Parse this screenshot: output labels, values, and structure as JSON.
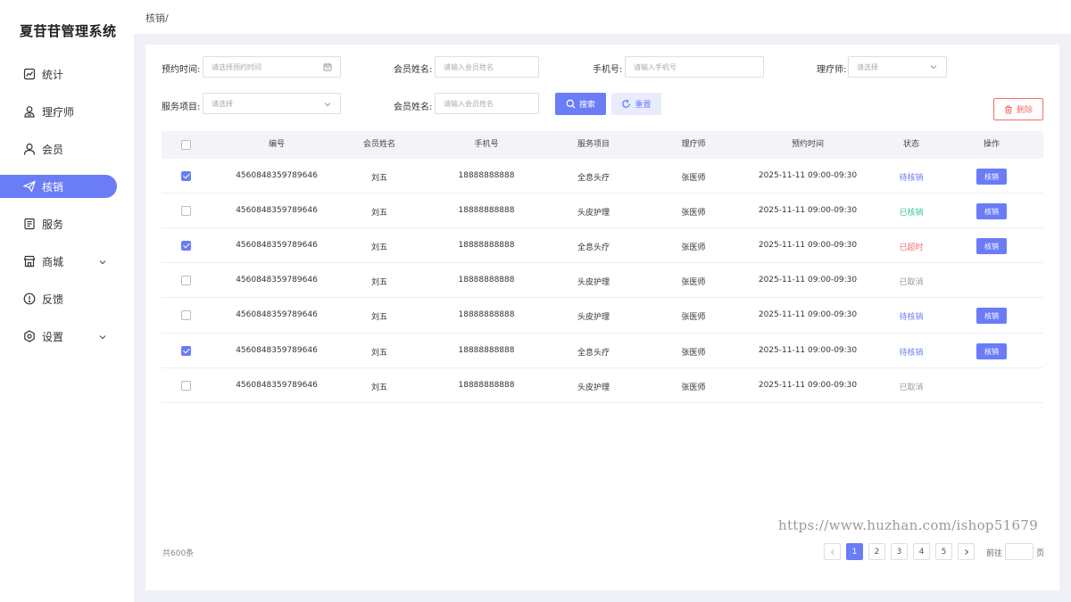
{
  "app": {
    "title": "夏苷苷管理系统"
  },
  "sidebar": {
    "items": [
      {
        "label": "统计",
        "icon": "chart-icon"
      },
      {
        "label": "理疗师",
        "icon": "therapist-icon"
      },
      {
        "label": "会员",
        "icon": "user-icon"
      },
      {
        "label": "核销",
        "icon": "paper-plane-icon",
        "active": true
      },
      {
        "label": "服务",
        "icon": "document-icon"
      },
      {
        "label": "商城",
        "icon": "store-icon",
        "expandable": true
      },
      {
        "label": "反馈",
        "icon": "alert-icon"
      },
      {
        "label": "设置",
        "icon": "gear-icon",
        "expandable": true
      }
    ]
  },
  "breadcrumb": "核销/",
  "filters": {
    "appointment_time": {
      "label": "预约时间:",
      "placeholder": "请选择预约时间"
    },
    "member_name": {
      "label": "会员姓名:",
      "placeholder": "请输入会员姓名"
    },
    "phone": {
      "label": "手机号:",
      "placeholder": "请输入手机号"
    },
    "therapist": {
      "label": "理疗师:",
      "placeholder": "请选择"
    },
    "service": {
      "label": "服务项目:",
      "placeholder": "请选择"
    },
    "member_name_2": {
      "label": "会员姓名:",
      "placeholder": "请输入会员姓名"
    }
  },
  "buttons": {
    "search": "搜索",
    "reset": "重置",
    "delete": "删除"
  },
  "table": {
    "columns": [
      "编号",
      "会员姓名",
      "手机号",
      "服务项目",
      "理疗师",
      "预约时间",
      "状态",
      "操作"
    ],
    "rows": [
      {
        "checked": true,
        "id": "4560848359789646",
        "name": "刘五",
        "phone": "18888888888",
        "service": "全息头疗",
        "therapist": "张医师",
        "time": "2025-11-11 09:00-09:30",
        "status": "待核销",
        "status_color": "#6b7cf7",
        "action": "核销"
      },
      {
        "checked": false,
        "id": "4560848359789646",
        "name": "刘五",
        "phone": "18888888888",
        "service": "头皮护理",
        "therapist": "张医师",
        "time": "2025-11-11 09:00-09:30",
        "status": "已核销",
        "status_color": "#3cc68a",
        "action": "核销"
      },
      {
        "checked": true,
        "id": "4560848359789646",
        "name": "刘五",
        "phone": "18888888888",
        "service": "全息头疗",
        "therapist": "张医师",
        "time": "2025-11-11 09:00-09:30",
        "status": "已超时",
        "status_color": "#f56c6c",
        "action": "核销"
      },
      {
        "checked": false,
        "id": "4560848359789646",
        "name": "刘五",
        "phone": "18888888888",
        "service": "头皮护理",
        "therapist": "张医师",
        "time": "2025-11-11 09:00-09:30",
        "status": "已取消",
        "status_color": "#999999",
        "action": ""
      },
      {
        "checked": false,
        "id": "4560848359789646",
        "name": "刘五",
        "phone": "18888888888",
        "service": "头皮护理",
        "therapist": "张医师",
        "time": "2025-11-11 09:00-09:30",
        "status": "待核销",
        "status_color": "#6b7cf7",
        "action": "核销"
      },
      {
        "checked": true,
        "id": "4560848359789646",
        "name": "刘五",
        "phone": "18888888888",
        "service": "全息头疗",
        "therapist": "张医师",
        "time": "2025-11-11 09:00-09:30",
        "status": "待核销",
        "status_color": "#6b7cf7",
        "action": "核销"
      },
      {
        "checked": false,
        "id": "4560848359789646",
        "name": "刘五",
        "phone": "18888888888",
        "service": "头皮护理",
        "therapist": "张医师",
        "time": "2025-11-11 09:00-09:30",
        "status": "已取消",
        "status_color": "#999999",
        "action": ""
      }
    ]
  },
  "footer": {
    "total": "共600条",
    "pages": [
      "1",
      "2",
      "3",
      "4",
      "5"
    ],
    "current_page": "1",
    "goto_label": "前往",
    "goto_suffix": "页"
  },
  "watermark": "https://www.huzhan.com/ishop51679",
  "colors": {
    "accent": "#6b7cf7",
    "danger": "#f56c6c",
    "success": "#3cc68a"
  }
}
